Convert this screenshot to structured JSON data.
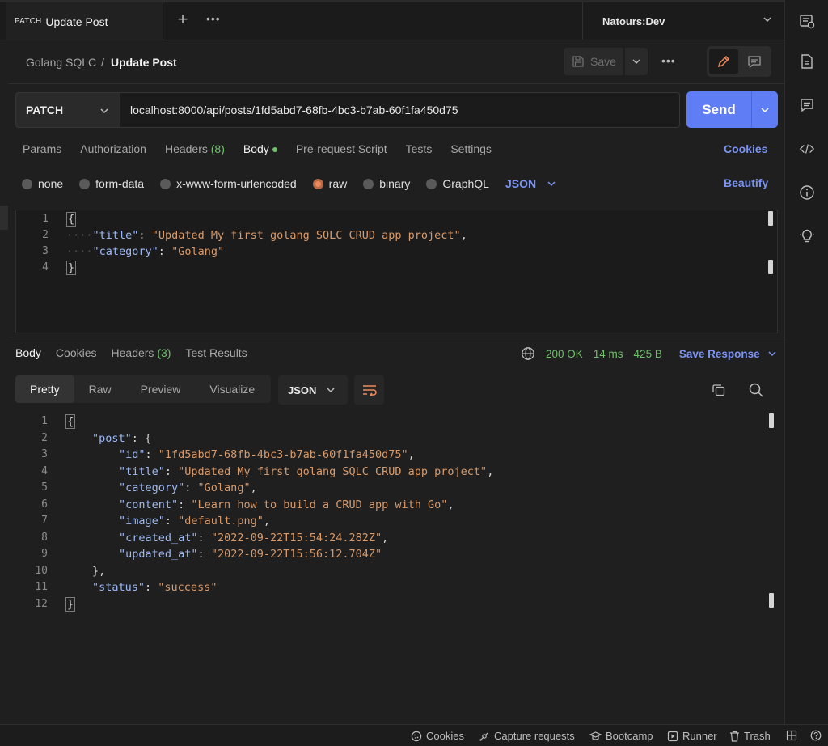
{
  "tab": {
    "method": "PATCH",
    "name": "Update Post"
  },
  "tabbar": {
    "new_tab": "+",
    "more": "•••"
  },
  "environment": {
    "name": "Natours:Dev"
  },
  "breadcrumb": {
    "parent": "Golang SQLC",
    "separator": "/",
    "current": "Update Post"
  },
  "toolbar": {
    "save_label": "Save",
    "more": "•••"
  },
  "request": {
    "method": "PATCH",
    "url": "localhost:8000/api/posts/1fd5abd7-68fb-4bc3-b7ab-60f1fa450d75",
    "send_label": "Send",
    "tabs": {
      "params": "Params",
      "authorization": "Authorization",
      "headers": "Headers",
      "headers_count": "(8)",
      "body": "Body",
      "prerequest": "Pre-request Script",
      "tests": "Tests",
      "settings": "Settings"
    },
    "cookies_link": "Cookies",
    "body_types": {
      "none": "none",
      "form_data": "form-data",
      "urlencoded": "x-www-form-urlencoded",
      "raw": "raw",
      "binary": "binary",
      "graphql": "GraphQL"
    },
    "body_format": "JSON",
    "beautify": "Beautify",
    "body_lines": {
      "l1": {
        "n": "1",
        "open": "{"
      },
      "l2": {
        "n": "2",
        "key": "\"title\"",
        "value": "\"Updated My first golang SQLC CRUD app project\""
      },
      "l3": {
        "n": "3",
        "key": "\"category\"",
        "value": "\"Golang\""
      },
      "l4": {
        "n": "4",
        "close": "}"
      }
    }
  },
  "response": {
    "tabs": {
      "body": "Body",
      "cookies": "Cookies",
      "headers": "Headers",
      "headers_count": "(3)",
      "tests": "Test Results"
    },
    "status": "200 OK",
    "time": "14 ms",
    "size": "425 B",
    "save_response": "Save Response",
    "view_tabs": {
      "pretty": "Pretty",
      "raw": "Raw",
      "preview": "Preview",
      "visualize": "Visualize"
    },
    "format": "JSON",
    "lines": {
      "l1": {
        "n": "1",
        "text": "{"
      },
      "l2": {
        "n": "2",
        "key": "\"post\"",
        "rest": ": {"
      },
      "l3": {
        "n": "3",
        "key": "\"id\"",
        "value": "\"1fd5abd7-68fb-4bc3-b7ab-60f1fa450d75\""
      },
      "l4": {
        "n": "4",
        "key": "\"title\"",
        "value": "\"Updated My first golang SQLC CRUD app project\""
      },
      "l5": {
        "n": "5",
        "key": "\"category\"",
        "value": "\"Golang\""
      },
      "l6": {
        "n": "6",
        "key": "\"content\"",
        "value": "\"Learn how to build a CRUD app with Go\""
      },
      "l7": {
        "n": "7",
        "key": "\"image\"",
        "value": "\"default.png\""
      },
      "l8": {
        "n": "8",
        "key": "\"created_at\"",
        "value": "\"2022-09-22T15:54:24.282Z\""
      },
      "l9": {
        "n": "9",
        "key": "\"updated_at\"",
        "value": "\"2022-09-22T15:56:12.704Z\""
      },
      "l10": {
        "n": "10",
        "text": "},"
      },
      "l11": {
        "n": "11",
        "key": "\"status\"",
        "value": "\"success\""
      },
      "l12": {
        "n": "12",
        "text": "}"
      }
    }
  },
  "statusbar": {
    "cookies": "Cookies",
    "capture": "Capture requests",
    "bootcamp": "Bootcamp",
    "runner": "Runner",
    "trash": "Trash"
  },
  "colors": {
    "accent": "#5f7ef6",
    "link": "#7b94f2",
    "success": "#6fc06a",
    "json_key": "#9cb9f5",
    "json_string": "#d99a6a",
    "raw_radio": "#f08a5d"
  }
}
